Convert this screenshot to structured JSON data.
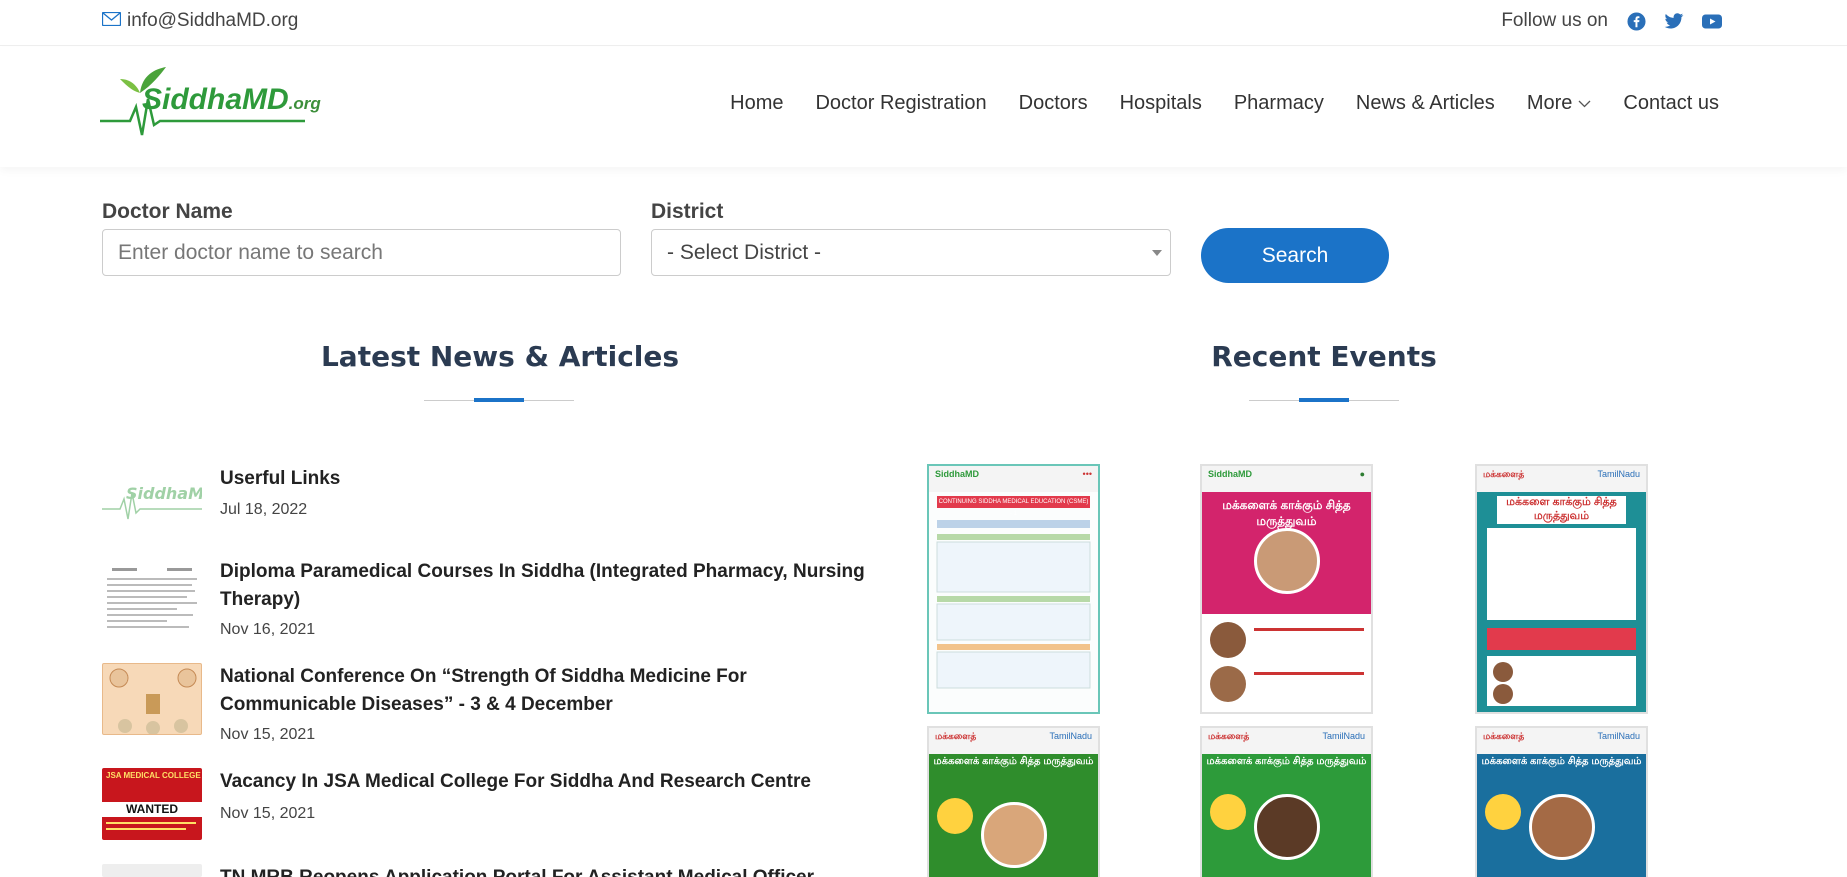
{
  "topbar": {
    "email": "info@SiddhaMD.org",
    "follow_label": "Follow us on",
    "social": [
      "facebook-icon",
      "twitter-icon",
      "youtube-icon"
    ]
  },
  "header": {
    "logo_text": "SiddhaMD",
    "logo_suffix": ".org",
    "nav": [
      "Home",
      "Doctor Registration",
      "Doctors",
      "Hospitals",
      "Pharmacy",
      "News & Articles",
      "More",
      "Contact us"
    ]
  },
  "search": {
    "doctor_label": "Doctor Name",
    "doctor_placeholder": "Enter doctor name to search",
    "district_label": "District",
    "district_value": "- Select District -",
    "button": "Search"
  },
  "news": {
    "title": "Latest News & Articles",
    "items": [
      {
        "title": "Userful Links",
        "date": "Jul 18, 2022"
      },
      {
        "title": "Diploma Paramedical Courses In Siddha (Integrated Pharmacy, Nursing Therapy)",
        "date": "Nov 16, 2021"
      },
      {
        "title": "National Conference On “Strength Of Siddha Medicine For Communicable Diseases” - 3 & 4 December",
        "date": "Nov 15, 2021"
      },
      {
        "title": "Vacancy In JSA Medical College For Siddha And Research Centre",
        "date": "Nov 15, 2021"
      },
      {
        "title": "TN MRB Reopens Application Portal For Assistant Medical Officer Recruitment",
        "date": ""
      }
    ]
  },
  "events": {
    "title": "Recent Events",
    "posters": [
      {
        "label": "CONTINUING SIDDHA MEDICAL EDUCATION (CSME) - 1",
        "color": "#e8f4f6"
      },
      {
        "label": "மக்களைக் காக்கும் சித்த மருத்துவம்",
        "color": "#d3246c"
      },
      {
        "label": "மக்களை காக்கும் சித்த மருத்துவம்",
        "color": "#1e8f96"
      },
      {
        "label": "மக்களைக் காக்கும் சித்த மருத்துவம்",
        "color": "#2f8d2c"
      },
      {
        "label": "மக்களைக் காக்கும் சித்த மருத்துவம்",
        "color": "#2d9b3a"
      },
      {
        "label": "மக்களைக் காக்கும் சித்த மருத்துவம்",
        "color": "#1a6f9e"
      }
    ]
  },
  "thumbs": {
    "wanted_label": "WANTED",
    "jsa_label": "JSA MEDICAL COLLEGE"
  }
}
